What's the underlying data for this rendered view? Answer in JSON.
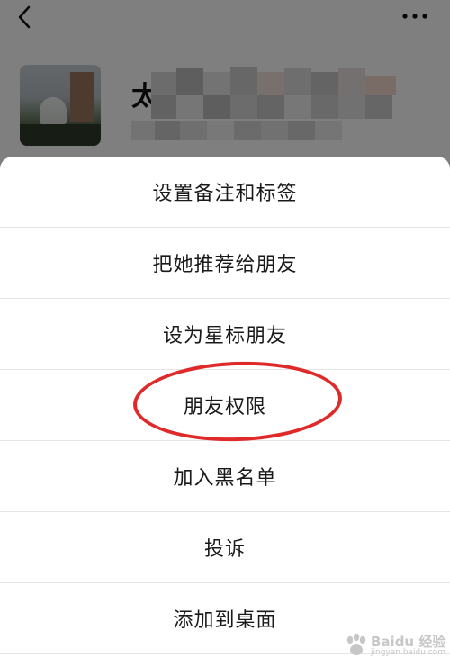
{
  "icons": {
    "back": "back-arrow-icon",
    "more": "more-dots-icon"
  },
  "profile": {
    "name_initial": "太"
  },
  "sheet": {
    "items": [
      {
        "label": "设置备注和标签",
        "highlighted": false
      },
      {
        "label": "把她推荐给朋友",
        "highlighted": false
      },
      {
        "label": "设为星标朋友",
        "highlighted": false
      },
      {
        "label": "朋友权限",
        "highlighted": true
      },
      {
        "label": "加入黑名单",
        "highlighted": false
      },
      {
        "label": "投诉",
        "highlighted": false
      },
      {
        "label": "添加到桌面",
        "highlighted": false
      }
    ]
  },
  "watermark": {
    "text": "Baidu 经验",
    "subtext": "jingyan.baidu.com"
  },
  "colors": {
    "highlight_ring": "#e02a2a",
    "overlay": "rgba(0,0,0,0.5)",
    "sheet_bg": "#ffffff",
    "text": "#1a1a1a"
  }
}
